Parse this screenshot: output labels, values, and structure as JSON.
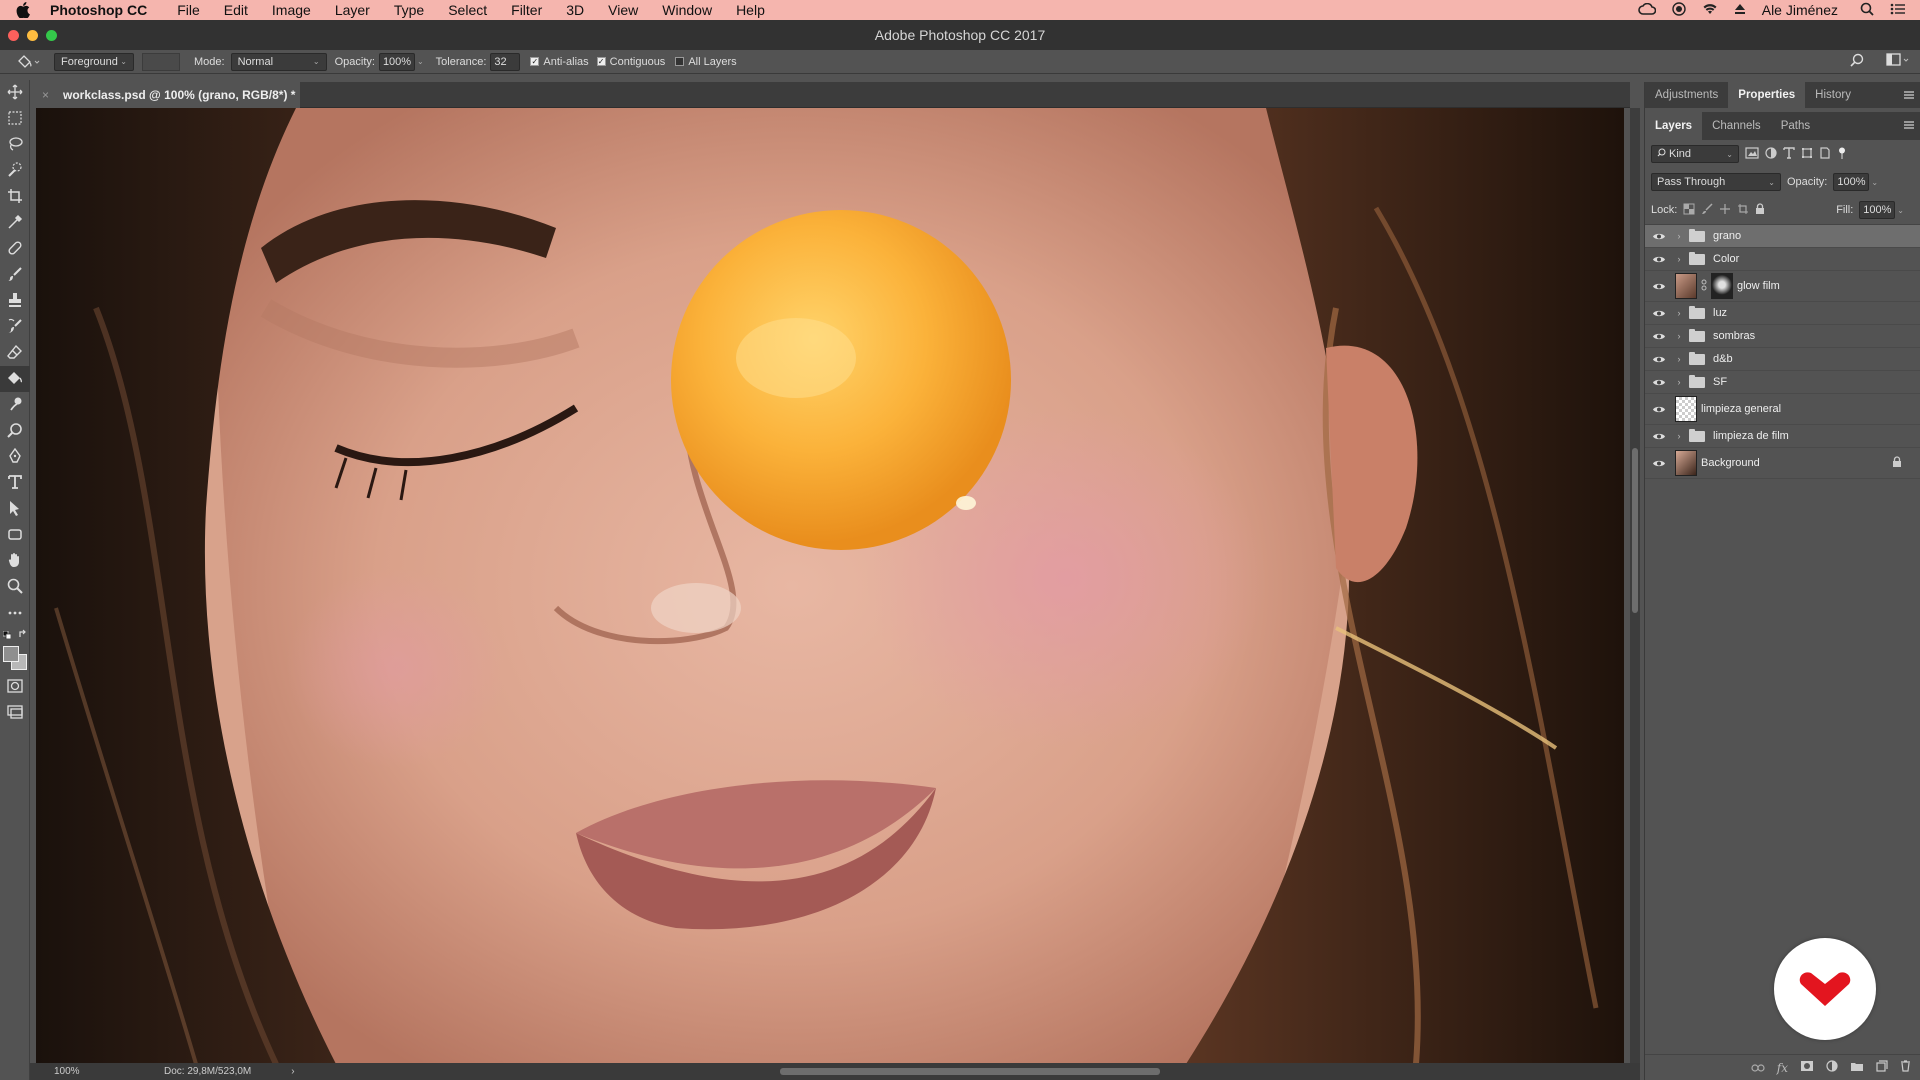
{
  "menubar": {
    "app_name": "Photoshop CC",
    "items": [
      "File",
      "Edit",
      "Image",
      "Layer",
      "Type",
      "Select",
      "Filter",
      "3D",
      "View",
      "Window",
      "Help"
    ],
    "user": "Ale Jiménez"
  },
  "window": {
    "title": "Adobe Photoshop CC 2017"
  },
  "options": {
    "fill_source": "Foreground",
    "mode_label": "Mode:",
    "mode_value": "Normal",
    "opacity_label": "Opacity:",
    "opacity_value": "100%",
    "tolerance_label": "Tolerance:",
    "tolerance_value": "32",
    "antialias_label": "Anti-alias",
    "antialias_checked": true,
    "contiguous_label": "Contiguous",
    "contiguous_checked": true,
    "all_layers_label": "All Layers",
    "all_layers_checked": false
  },
  "document": {
    "tab_title": "workclass.psd @ 100% (grano, RGB/8*) *",
    "close_glyph": "×"
  },
  "status": {
    "zoom": "100%",
    "doc": "Doc: 29,8M/523,0M",
    "arrow": "›"
  },
  "panels": {
    "top_tabs": [
      "Adjustments",
      "Properties",
      "History"
    ],
    "top_active": "Properties",
    "layer_tabs": [
      "Layers",
      "Channels",
      "Paths"
    ],
    "layer_active": "Layers",
    "filter_kind": "Kind",
    "blend_mode": "Pass Through",
    "opacity_label": "Opacity:",
    "opacity_value": "100%",
    "lock_label": "Lock:",
    "fill_label": "Fill:",
    "fill_value": "100%"
  },
  "layers": [
    {
      "name": "grano",
      "type": "group",
      "selected": true
    },
    {
      "name": "Color",
      "type": "group",
      "selected": false
    },
    {
      "name": "glow film",
      "type": "adjust-masked",
      "selected": false
    },
    {
      "name": "luz",
      "type": "group",
      "selected": false
    },
    {
      "name": "sombras",
      "type": "group",
      "selected": false
    },
    {
      "name": "d&b",
      "type": "group",
      "selected": false
    },
    {
      "name": "SF",
      "type": "group",
      "selected": false
    },
    {
      "name": "limpieza general",
      "type": "transparent",
      "selected": false
    },
    {
      "name": "limpieza de film",
      "type": "group",
      "selected": false
    },
    {
      "name": "Background",
      "type": "image-locked",
      "selected": false
    }
  ],
  "colors": {
    "menubar_bg": "#f5b5ae",
    "ui_bg": "#535353",
    "logo_red": "#e3151f"
  }
}
